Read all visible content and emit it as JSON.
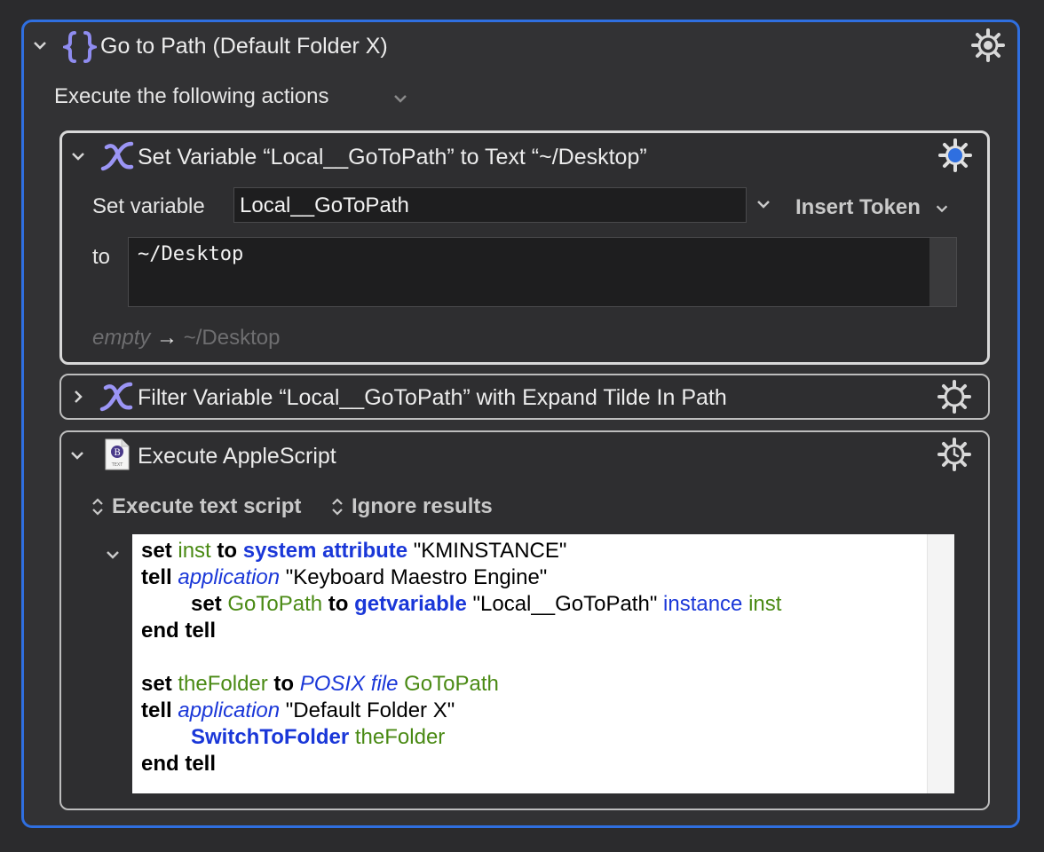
{
  "group": {
    "title": "Go to Path (Default Folder X)",
    "execute_label": "Execute the following actions"
  },
  "set_variable": {
    "title": "Set Variable “Local__GoToPath” to Text “~/Desktop”",
    "set_variable_label": "Set variable",
    "variable_name": "Local__GoToPath",
    "insert_token_label": "Insert Token",
    "to_label": "to",
    "text_value": "~/Desktop",
    "preview_empty": "empty",
    "preview_arrow": "→",
    "preview_result": "~/Desktop"
  },
  "filter_variable": {
    "title": "Filter Variable “Local__GoToPath” with Expand Tilde In Path"
  },
  "applescript": {
    "title": "Execute AppleScript",
    "mode_label": "Execute text script",
    "results_label": "Ignore results",
    "lines": [
      [
        {
          "t": "set",
          "c": "kw"
        },
        {
          "t": " "
        },
        {
          "t": "inst",
          "c": "var"
        },
        {
          "t": " "
        },
        {
          "t": "to",
          "c": "kw"
        },
        {
          "t": " "
        },
        {
          "t": "system attribute",
          "c": "kwb"
        },
        {
          "t": " \"KMINSTANCE\""
        }
      ],
      [
        {
          "t": "tell",
          "c": "kw"
        },
        {
          "t": " "
        },
        {
          "t": "application",
          "c": "app"
        },
        {
          "t": " \"Keyboard Maestro Engine\""
        }
      ],
      [
        {
          "t": "set",
          "c": "kw",
          "i": true
        },
        {
          "t": " "
        },
        {
          "t": "GoToPath",
          "c": "var"
        },
        {
          "t": " "
        },
        {
          "t": "to",
          "c": "kw"
        },
        {
          "t": " "
        },
        {
          "t": "getvariable",
          "c": "kwb"
        },
        {
          "t": " \"Local__GoToPath\" "
        },
        {
          "t": "instance",
          "c": "prop"
        },
        {
          "t": " "
        },
        {
          "t": "inst",
          "c": "var"
        }
      ],
      [
        {
          "t": "end tell",
          "c": "kw"
        }
      ],
      [
        {
          "t": ""
        }
      ],
      [
        {
          "t": "set",
          "c": "kw"
        },
        {
          "t": " "
        },
        {
          "t": "theFolder",
          "c": "var"
        },
        {
          "t": " "
        },
        {
          "t": "to",
          "c": "kw"
        },
        {
          "t": " "
        },
        {
          "t": "POSIX file",
          "c": "app"
        },
        {
          "t": " "
        },
        {
          "t": "GoToPath",
          "c": "var"
        }
      ],
      [
        {
          "t": "tell",
          "c": "kw"
        },
        {
          "t": " "
        },
        {
          "t": "application",
          "c": "app"
        },
        {
          "t": " \"Default Folder X\""
        }
      ],
      [
        {
          "t": "SwitchToFolder",
          "c": "kwb",
          "i": true
        },
        {
          "t": " "
        },
        {
          "t": "theFolder",
          "c": "var"
        }
      ],
      [
        {
          "t": "end tell",
          "c": "kw"
        }
      ]
    ]
  },
  "icons": {
    "group": "curly-braces-icon",
    "variable": "variable-x-icon",
    "script": "applescript-file-icon",
    "gear": "gear-icon"
  },
  "colors": {
    "accent": "#2f6fe0",
    "selected_gear": "#2f6fe0"
  }
}
